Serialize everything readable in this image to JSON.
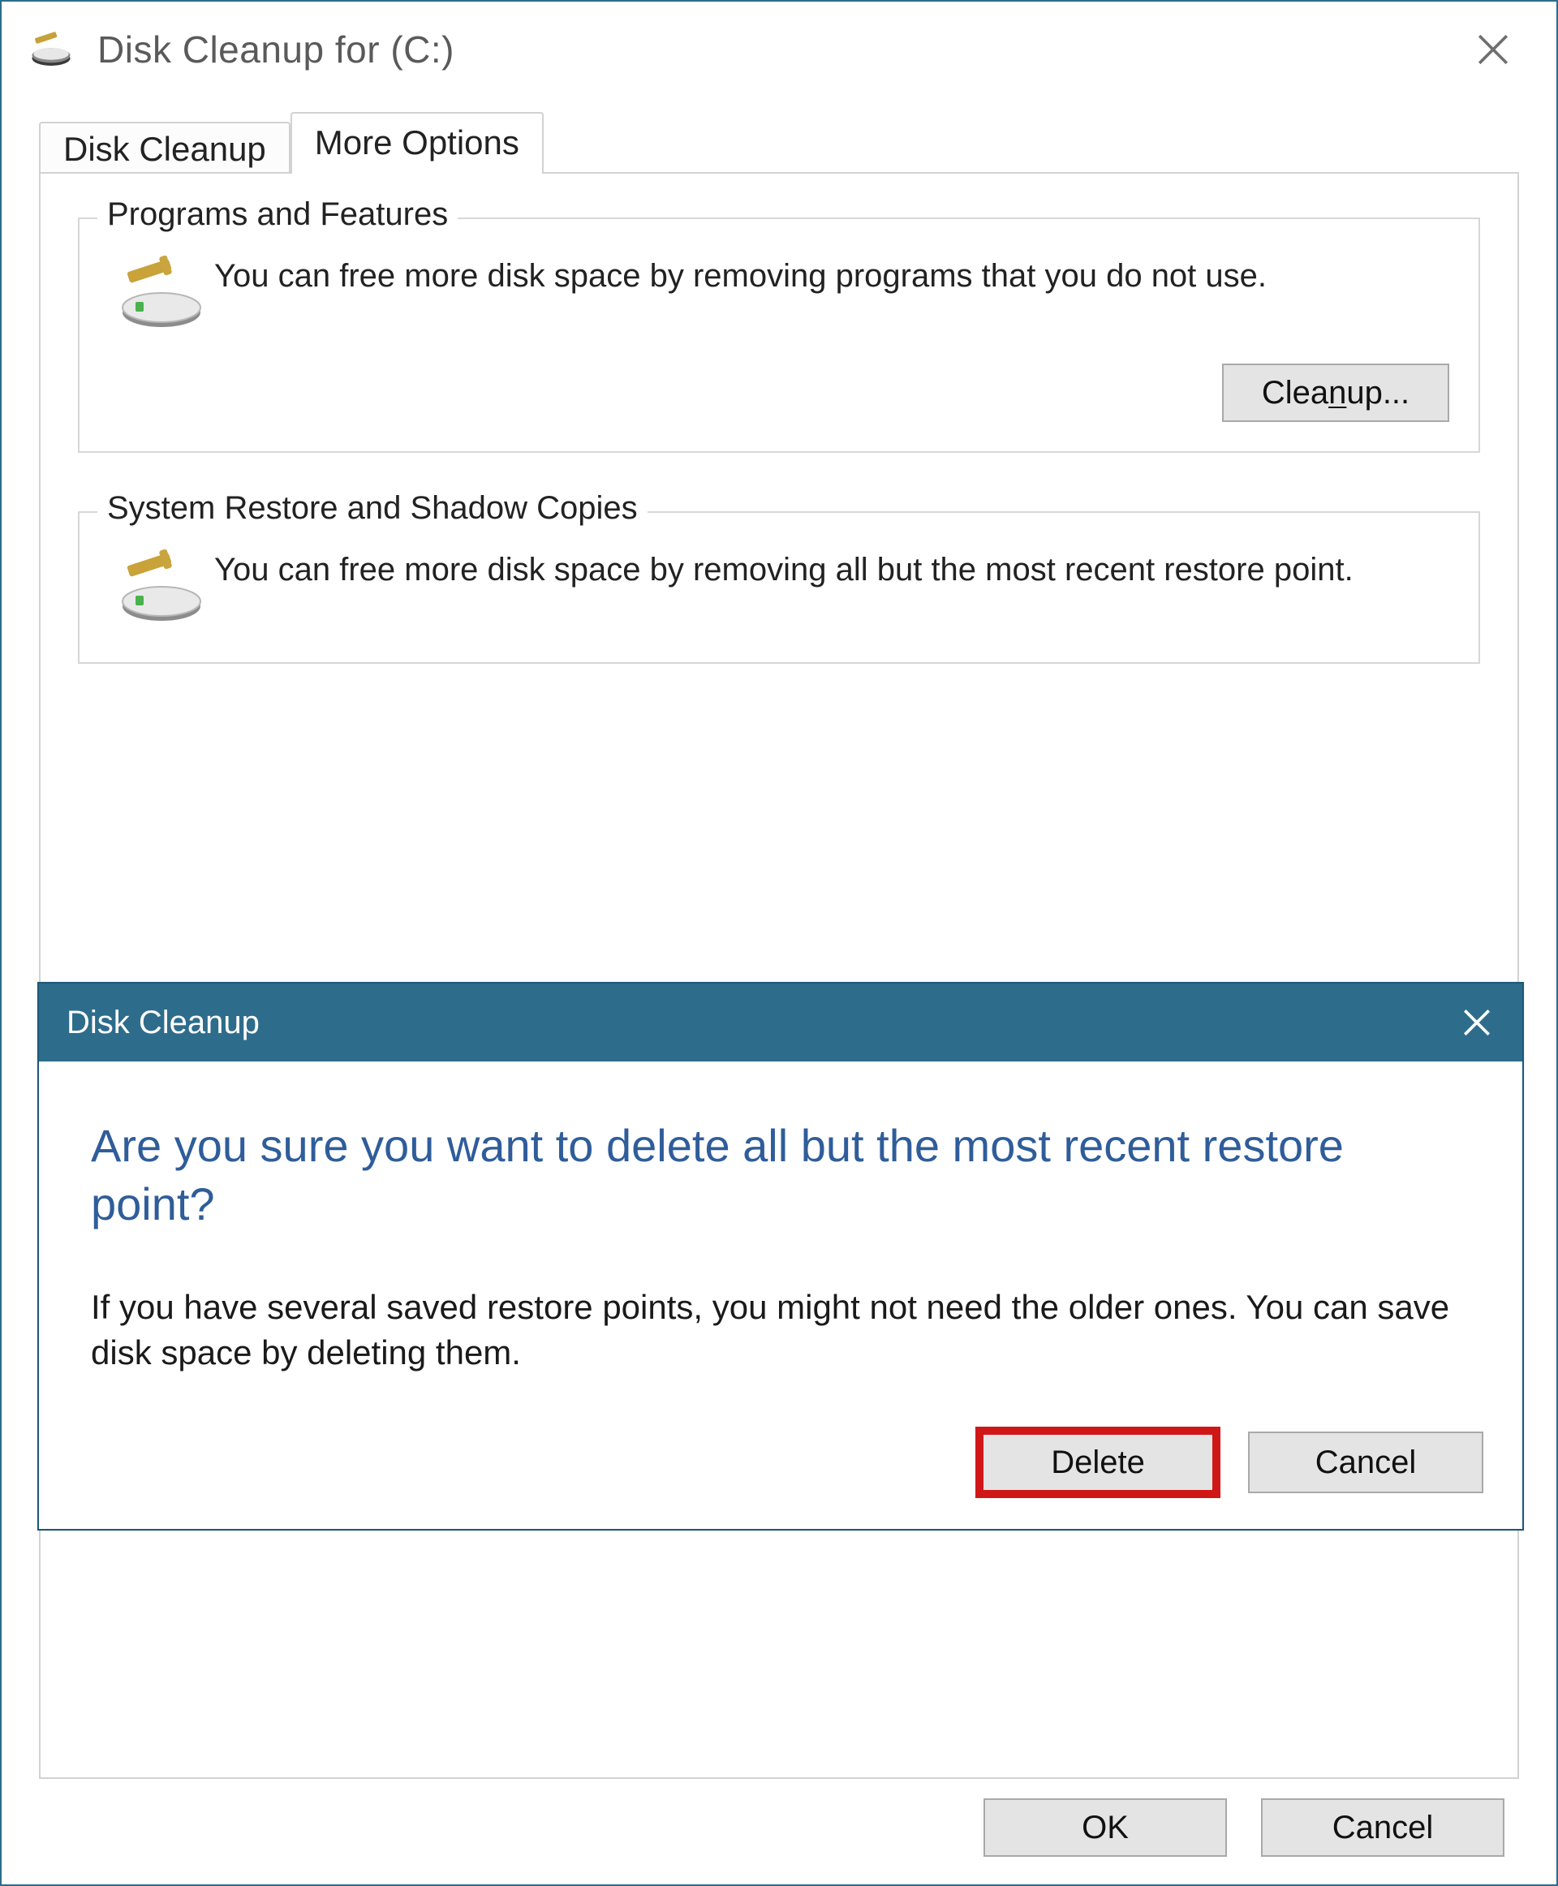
{
  "window": {
    "title": "Disk Cleanup for  (C:)",
    "tabs": {
      "disk_cleanup": "Disk Cleanup",
      "more_options": "More Options"
    },
    "groups": {
      "programs": {
        "legend": "Programs and Features",
        "text": "You can free more disk space by removing programs that you do not use.",
        "button_pre": "Clea",
        "button_acc": "n",
        "button_post": " up..."
      },
      "restore": {
        "legend": "System Restore and Shadow Copies",
        "text": "You can free more disk space by removing all but the most recent restore point."
      }
    },
    "ok": "OK",
    "cancel": "Cancel"
  },
  "modal": {
    "title": "Disk Cleanup",
    "heading": "Are you sure you want to delete all but the most recent restore point?",
    "text": "If you have several saved restore points, you might not need the older ones. You can save disk space by deleting them.",
    "delete": "Delete",
    "cancel": "Cancel"
  }
}
